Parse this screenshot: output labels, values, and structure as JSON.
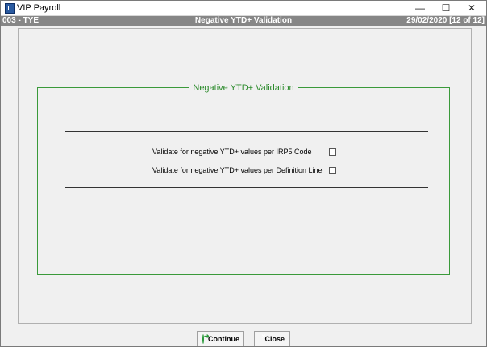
{
  "window": {
    "title": "VIP Payroll",
    "minimize_glyph": "—",
    "maximize_glyph": "☐",
    "close_glyph": "✕"
  },
  "infobar": {
    "left": "003 - TYE",
    "center": "Negative YTD+ Validation",
    "right": "29/02/2020 [12 of 12]"
  },
  "group": {
    "title": "Negative YTD+ Validation",
    "options": [
      {
        "label": "Validate for negative YTD+ values per IRP5 Code",
        "checked": false
      },
      {
        "label": "Validate for negative YTD+ values per Definition Line",
        "checked": false
      }
    ]
  },
  "buttons": {
    "continue_label": "Continue",
    "close_label": "Close"
  },
  "icons": {
    "app": "vip-app-icon",
    "continue": "arrow-circle-right-icon",
    "close": "close-circle-icon"
  },
  "colors": {
    "accent_green": "#2a8a2a",
    "infobar": "#868686"
  }
}
